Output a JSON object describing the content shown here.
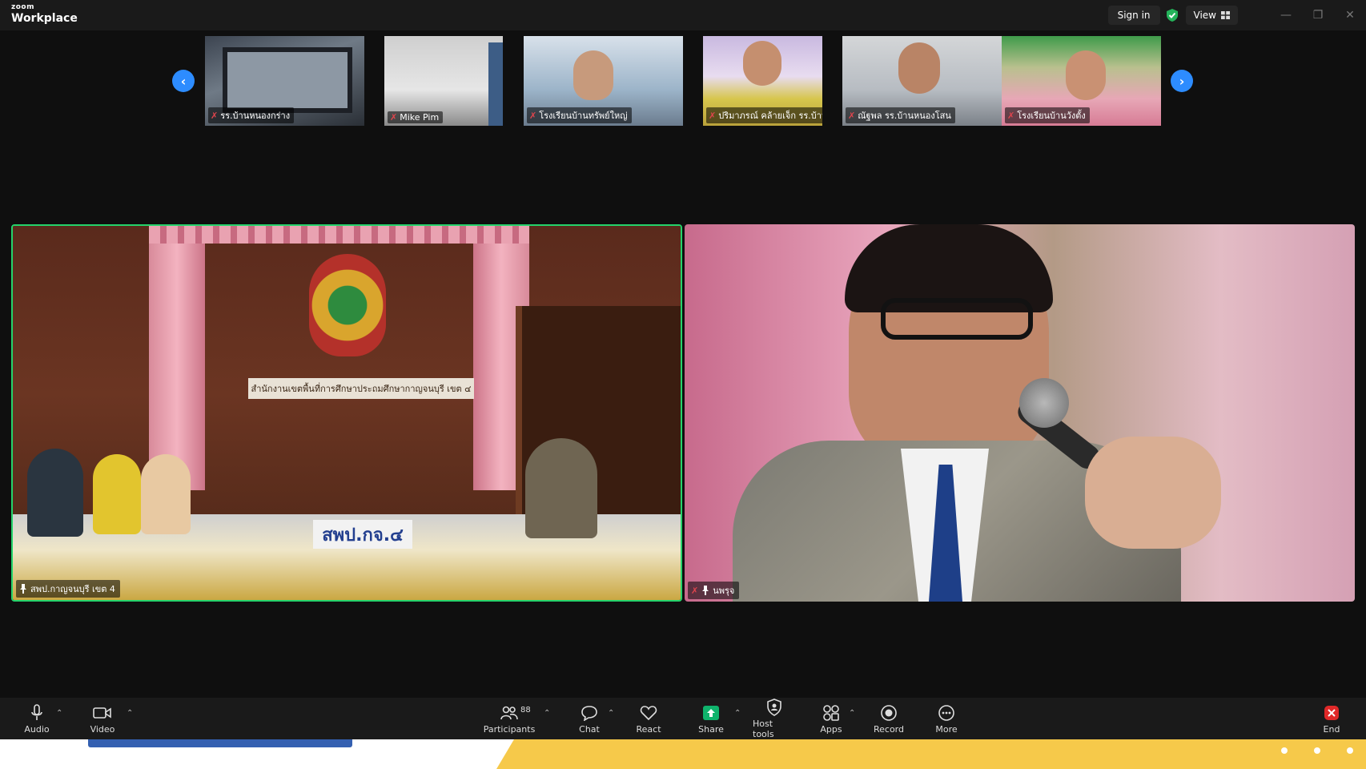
{
  "app": {
    "brand_top": "zoom",
    "brand_main": "Workplace"
  },
  "titlebar": {
    "sign_in": "Sign in",
    "view": "View"
  },
  "thumbnails": [
    {
      "name": "รร.บ้านหนองกร่าง",
      "muted": true
    },
    {
      "name": "Mike Pim",
      "muted": true
    },
    {
      "name": "โรงเรียนบ้านทรัพย์ใหญ่",
      "muted": true
    },
    {
      "name": "ปริมาภรณ์ คล้ายเจ็ก รร.บ้านเขาบางสา...",
      "muted": true
    },
    {
      "name": "ณัฐพล รร.บ้านหนองโสน",
      "muted": true
    },
    {
      "name": "โรงเรียนบ้านวังตั้ง",
      "muted": true
    }
  ],
  "main_videos": {
    "left": {
      "name": "สพป.กาญจนบุรี เขต 4",
      "pinned": true,
      "active_speaker": true,
      "sign_text": "สำนักงานเขตพื้นที่การศึกษาประถมศึกษากาญจนบุรี เขต ๔",
      "table_sign": "สพป.กจ.๔"
    },
    "right": {
      "name": "นพรุจ",
      "pinned": true,
      "muted": true
    }
  },
  "toolbar": {
    "audio": "Audio",
    "video": "Video",
    "participants": "Participants",
    "participants_count": "88",
    "chat": "Chat",
    "react": "React",
    "share": "Share",
    "host_tools": "Host tools",
    "apps": "Apps",
    "record": "Record",
    "more": "More",
    "end": "End"
  },
  "colors": {
    "accent": "#2d8cff",
    "active_speaker": "#24d36b",
    "share": "#0fb36c",
    "end": "#e02828",
    "muted": "#e0454d"
  }
}
